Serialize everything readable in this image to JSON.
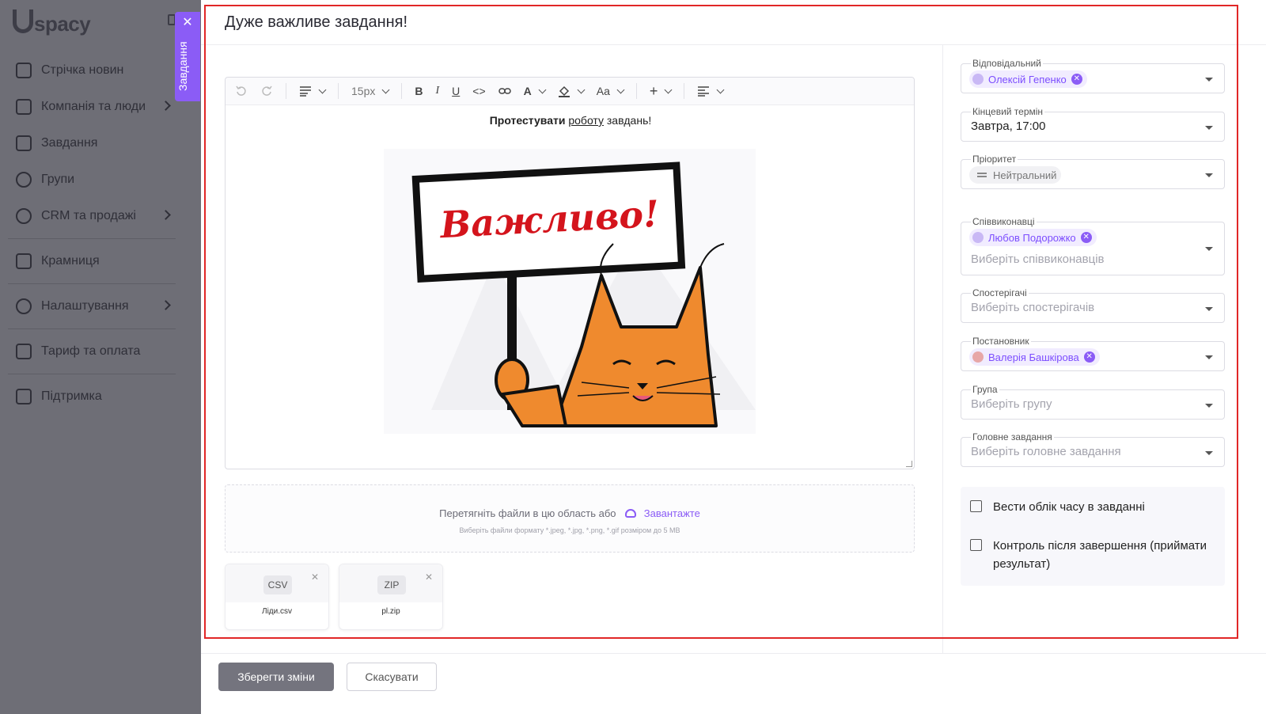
{
  "app": {
    "logo": "spacy"
  },
  "sidebar": {
    "items": [
      {
        "label": "Стрічка новин",
        "icon": "home-icon"
      },
      {
        "label": "Компанія та люди",
        "icon": "building-icon"
      },
      {
        "label": "Завдання",
        "icon": "calendar-icon"
      },
      {
        "label": "Групи",
        "icon": "users-icon"
      },
      {
        "label": "CRM та продажі",
        "icon": "database-icon"
      },
      {
        "label": "Крамниця",
        "icon": "store-icon"
      },
      {
        "label": "Налаштування",
        "icon": "gear-icon"
      },
      {
        "label": "Тариф та оплата",
        "icon": "wallet-icon"
      },
      {
        "label": "Підтримка",
        "icon": "help-icon"
      }
    ]
  },
  "vtab": {
    "label": "Завдання",
    "close": "✕"
  },
  "task": {
    "title": "Дуже важливе завдання!",
    "body": {
      "bold": "Протестувати",
      "underlined": "роботу",
      "rest": "завдань!"
    },
    "sign_text": "Важливо!"
  },
  "toolbar": {
    "font_size": "15px",
    "font_label": "Aa"
  },
  "dropzone": {
    "text": "Перетягніть файли в цю область або",
    "upload": "Завантажте",
    "hint": "Виберіть файли формату *.jpeg, *.jpg, *.png, *.gif розміром до 5 МВ"
  },
  "files": [
    {
      "ext": "CSV",
      "name": "Ліди.csv"
    },
    {
      "ext": "ZIP",
      "name": "pl.zip"
    }
  ],
  "fields": {
    "responsible": {
      "label": "Відповідальний",
      "value": "Олексій Гепенко"
    },
    "deadline": {
      "label": "Кінцевий термін",
      "value": "Завтра, 17:00"
    },
    "priority": {
      "label": "Пріоритет",
      "value": "Нейтральний"
    },
    "coexecutors": {
      "label": "Співвиконавці",
      "value": "Любов Подорожко",
      "placeholder": "Виберіть співвиконавців"
    },
    "observers": {
      "label": "Спостерігачі",
      "placeholder": "Виберіть спостерігачів"
    },
    "author": {
      "label": "Постановник",
      "value": "Валерія Башкірова"
    },
    "group": {
      "label": "Група",
      "placeholder": "Виберіть групу"
    },
    "parent": {
      "label": "Головне завдання",
      "placeholder": "Виберіть головне завдання"
    }
  },
  "checkboxes": {
    "time_tracking": "Вести облік часу в завданні",
    "control": "Контроль після завершення (приймати результат)"
  },
  "footer": {
    "save": "Зберегти зміни",
    "cancel": "Скасувати"
  },
  "colors": {
    "accent": "#8b5cf6",
    "frame": "#e12727",
    "sign_text": "#d4141c",
    "cat": "#ef8a2e"
  }
}
